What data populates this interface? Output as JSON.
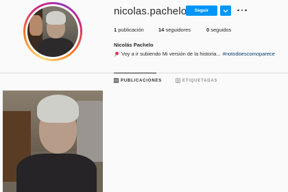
{
  "profile": {
    "username": "nicolas.pachelo",
    "follow_label": "Seguir",
    "full_name": "Nicolás Pachelo",
    "bio_text": "Voy a ir subiendo Mi versión de la historia...",
    "bio_hashtag": "#notodoescomoparece"
  },
  "stats": {
    "posts_count": "1",
    "posts_label": "publicación",
    "followers_count": "14",
    "followers_label": "seguidores",
    "following_count": "0",
    "following_label": "seguidos"
  },
  "tabs": [
    {
      "label": "PUBLICACIONES",
      "active": true
    },
    {
      "label": "ETIQUETADAS",
      "active": false
    }
  ],
  "colors": {
    "accent": "#0095f6",
    "text": "#262626",
    "muted": "#8e8e8e",
    "hashtag": "#00376b",
    "background": "#fafafa"
  },
  "icons": {
    "dropdown": "chevron-down-icon",
    "more": "more-options-icon",
    "pin": "pushpin-icon",
    "grid": "grid-icon",
    "tagged": "tagged-icon"
  }
}
